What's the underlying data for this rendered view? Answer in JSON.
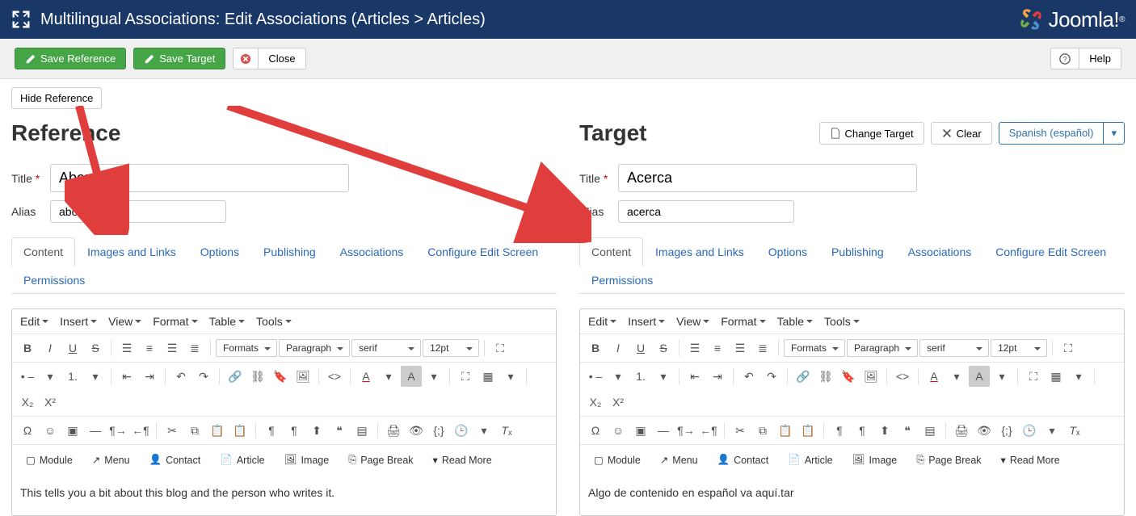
{
  "header": {
    "title": "Multilingual Associations: Edit Associations (Articles > Articles)",
    "brand": "Joomla!"
  },
  "toolbar": {
    "save_reference": "Save Reference",
    "save_target": "Save Target",
    "close": "Close",
    "help": "Help"
  },
  "subbar": {
    "hide_reference": "Hide Reference"
  },
  "reference": {
    "heading": "Reference",
    "title_label": "Title",
    "title_value": "About",
    "alias_label": "Alias",
    "alias_value": "about",
    "content": "This tells you a bit about this blog and the person who writes it."
  },
  "target": {
    "heading": "Target",
    "change_target": "Change Target",
    "clear": "Clear",
    "language": "Spanish (español)",
    "title_label": "Title",
    "title_value": "Acerca",
    "alias_label": "Alias",
    "alias_value": "acerca",
    "content": "Algo de contenido en español va aquí.tar"
  },
  "tabs": [
    "Content",
    "Images and Links",
    "Options",
    "Publishing",
    "Associations",
    "Configure Edit Screen",
    "Permissions"
  ],
  "editor": {
    "menubar": [
      "Edit",
      "Insert",
      "View",
      "Format",
      "Table",
      "Tools"
    ],
    "formats": "Formats",
    "paragraph": "Paragraph",
    "font": "serif",
    "size": "12pt",
    "bottom": [
      "Module",
      "Menu",
      "Contact",
      "Article",
      "Image",
      "Page Break",
      "Read More"
    ]
  }
}
